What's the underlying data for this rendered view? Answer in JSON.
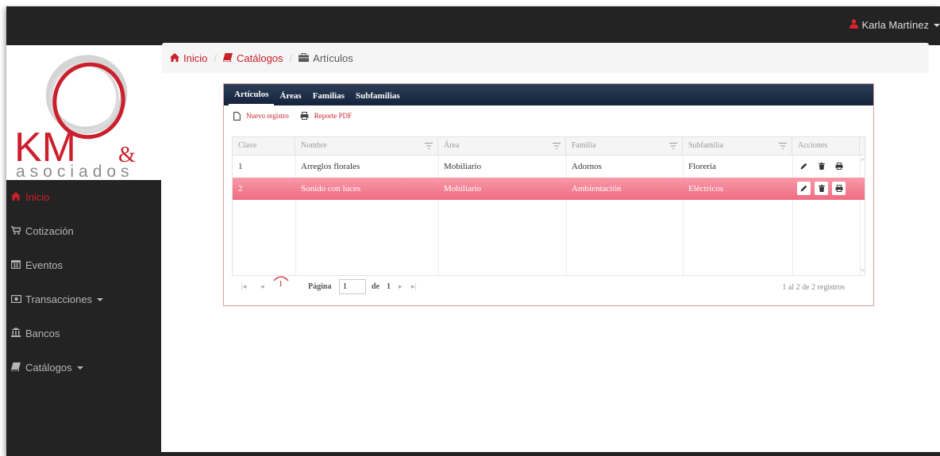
{
  "header": {
    "user_name": "Karla Martínez"
  },
  "logo": {
    "brand": "KM",
    "ampersand": "&",
    "tagline": "asociados"
  },
  "sidebar": {
    "items": [
      {
        "label": "Inicio",
        "icon": "home-icon"
      },
      {
        "label": "Cotización",
        "icon": "cart-icon"
      },
      {
        "label": "Eventos",
        "icon": "calendar-icon"
      },
      {
        "label": "Transacciones",
        "icon": "money-icon",
        "dropdown": true
      },
      {
        "label": "Bancos",
        "icon": "bank-icon"
      },
      {
        "label": "Catálogos",
        "icon": "book-icon",
        "dropdown": true
      }
    ]
  },
  "breadcrumb": [
    {
      "label": "Inicio",
      "icon": "home-icon"
    },
    {
      "label": "Catálogos",
      "icon": "book-icon"
    },
    {
      "label": "Artículos",
      "icon": "briefcase-icon"
    }
  ],
  "tabs": [
    "Artículos",
    "Áreas",
    "Familias",
    "Subfamilias"
  ],
  "toolbar": {
    "new_label": "Nuevo registro",
    "pdf_label": "Reporte PDF"
  },
  "table": {
    "columns": [
      "Clave",
      "Nombre",
      "Área",
      "Familia",
      "Subfamilia",
      "Acciones"
    ],
    "rows": [
      [
        "1",
        "Arreglos florales",
        "Mobiliario",
        "Adornos",
        "Florería"
      ],
      [
        "2",
        "Sonido con luces",
        "Mobiliario",
        "Ambientación",
        "Eléctricos"
      ]
    ],
    "selected_row": 1
  },
  "pager": {
    "current_page": "1",
    "page_label": "Página",
    "of_label": "de",
    "total_pages": "1",
    "page_value": "1",
    "records": "1 al 2 de 2 registros"
  },
  "colors": {
    "accent": "#c9202a",
    "dark": "#232323",
    "selected_row": "#f38195",
    "tabs_bg": "#1c2c45"
  }
}
